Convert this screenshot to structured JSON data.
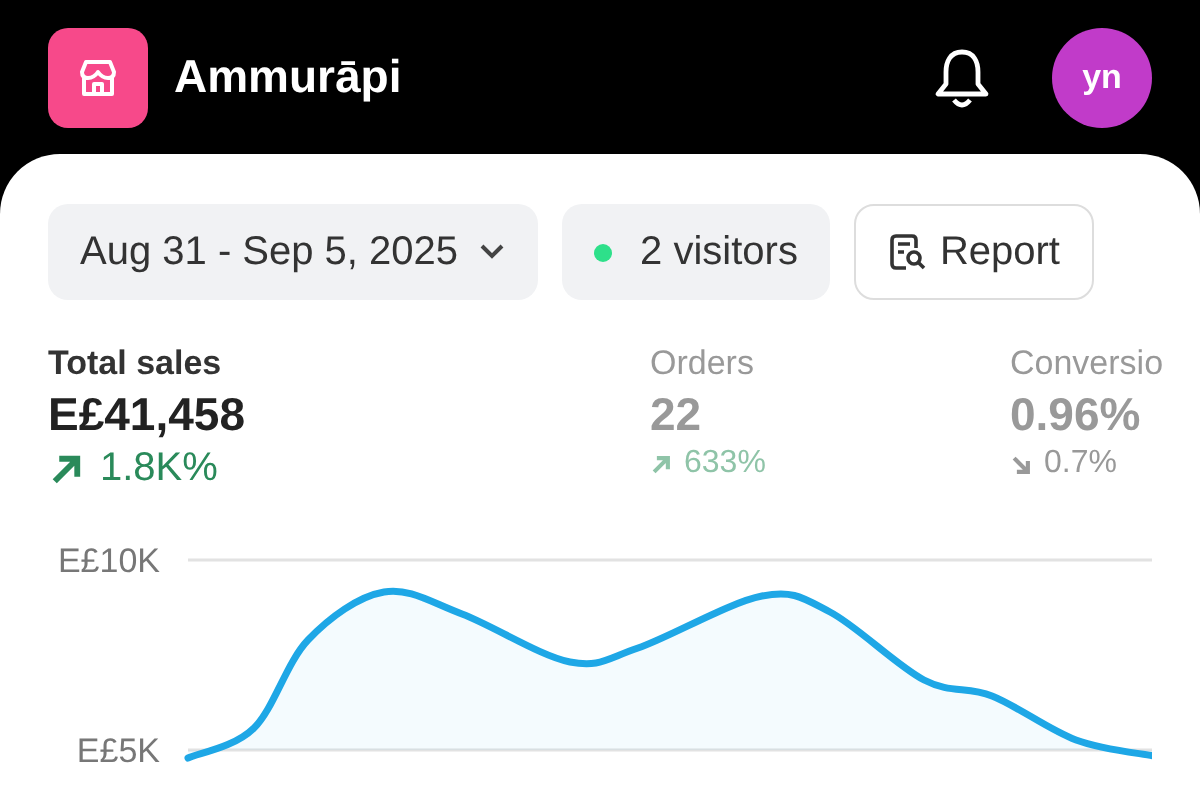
{
  "header": {
    "store_name": "Ammurāpi",
    "avatar_initials": "yn"
  },
  "toolbar": {
    "date_range": "Aug 31 - Sep 5, 2025",
    "visitors": "2 visitors",
    "report_button": "Report"
  },
  "metrics": [
    {
      "label": "Total sales",
      "value": "E£41,458",
      "kind": "up",
      "change": "1.8K%",
      "selected": true
    },
    {
      "label": "Orders",
      "value": "22",
      "kind": "up",
      "change": "633%",
      "selected": false
    },
    {
      "label": "Conversio",
      "value": "0.96%",
      "kind": "down",
      "change": "0.7%",
      "selected": false
    }
  ],
  "sales_chart": {
    "y_labels": [
      "E£10K",
      "E£5K"
    ]
  }
}
